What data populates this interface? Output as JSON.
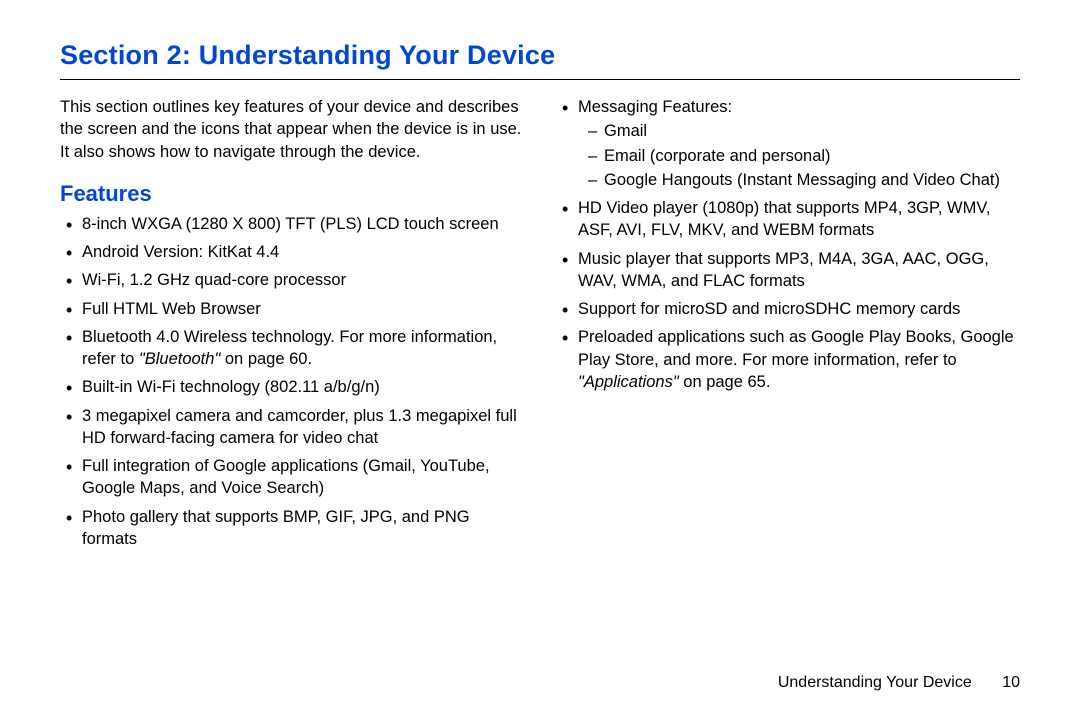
{
  "title": "Section 2: Understanding Your Device",
  "intro": "This section outlines key features of your device and describes the screen and the icons that appear when the device is in use. It also shows how to navigate through the device.",
  "features_head": "Features",
  "col1": {
    "f0": "8-inch WXGA (1280 X 800) TFT (PLS) LCD touch screen",
    "f1": "Android Version: KitKat 4.4",
    "f2": "Wi-Fi, 1.2 GHz quad-core processor",
    "f3": "Full HTML Web Browser",
    "f4a": "Bluetooth 4.0 Wireless technology. For more information, refer to ",
    "f4b": "\"Bluetooth\"",
    "f4c": " on page 60.",
    "f5": "Built-in Wi-Fi technology (802.11 a/b/g/n)",
    "f6": "3 megapixel camera and camcorder, plus 1.3 megapixel full HD forward-facing camera for video chat",
    "f7": "Full integration of Google applications (Gmail, YouTube, Google Maps, and Voice Search)",
    "f8": "Photo gallery that supports BMP, GIF, JPG, and PNG formats"
  },
  "col2": {
    "m_head": "Messaging Features:",
    "m0": "Gmail",
    "m1": "Email (corporate and personal)",
    "m2": "Google Hangouts (Instant Messaging and Video Chat)",
    "f1": "HD Video player (1080p) that supports MP4, 3GP, WMV, ASF, AVI, FLV, MKV, and WEBM formats",
    "f2": "Music player that supports MP3, M4A, 3GA, AAC, OGG, WAV, WMA, and FLAC formats",
    "f3": "Support for microSD and microSDHC memory cards",
    "f4a": "Preloaded applications such as Google Play Books, Google Play Store, and more. For more information, refer to ",
    "f4b": "\"Applications\"",
    "f4c": " on page 65."
  },
  "footer": {
    "label": "Understanding Your Device",
    "page": "10"
  }
}
